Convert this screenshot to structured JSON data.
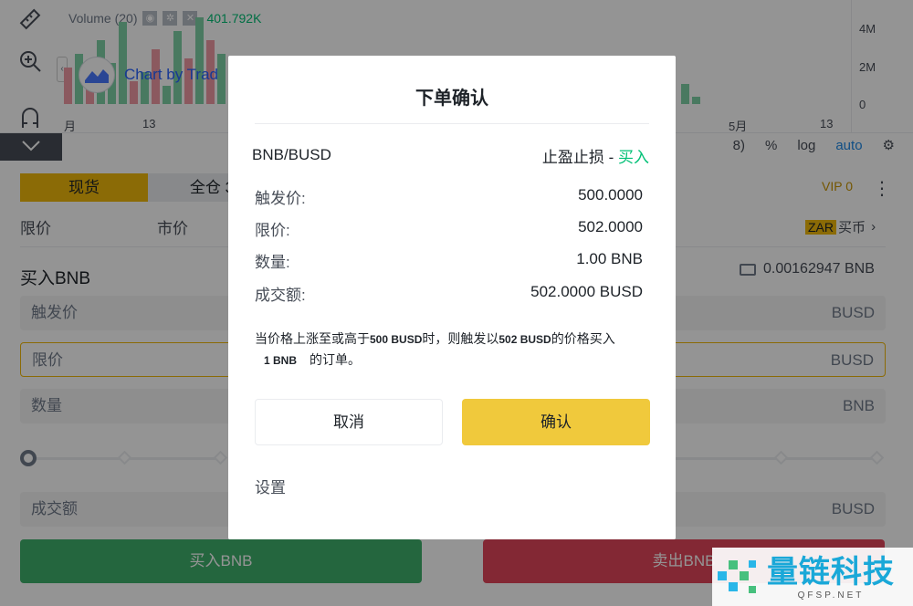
{
  "chart": {
    "legend_title": "Volume (20)",
    "legend_value": "401.792K",
    "tradingview_label": "Chart by Trad",
    "x_labels": [
      "月",
      "13",
      "5月",
      "13"
    ],
    "y_labels": [
      "4M",
      "2M",
      "0"
    ],
    "toolbar": {
      "partial": "8)",
      "percent": "%",
      "log": "log",
      "auto": "auto"
    }
  },
  "trade_panel": {
    "tabs": [
      "现货",
      "全仓 3"
    ],
    "vip": "VIP 0",
    "order_types": [
      "限价",
      "市价"
    ],
    "zar_badge": "ZAR",
    "buy_coin": "买币",
    "buy_title": "买入BNB",
    "balance": "0.00162947 BNB",
    "fields": {
      "trigger": {
        "placeholder": "触发价",
        "unit": "BUSD"
      },
      "limit": {
        "placeholder": "限价",
        "unit": "BUSD"
      },
      "amount": {
        "placeholder": "数量",
        "unit": "BNB"
      },
      "total": {
        "placeholder": "成交额",
        "unit": "BUSD"
      }
    },
    "buy_button": "买入BNB",
    "sell_button": "卖出BNB"
  },
  "modal": {
    "title": "下单确认",
    "pair": "BNB/BUSD",
    "order_type": "止盈止损 - ",
    "side": "买入",
    "rows": [
      {
        "label": "触发价:",
        "value": "500.0000"
      },
      {
        "label": "限价:",
        "value": "502.0000"
      },
      {
        "label": "数量:",
        "value": "1.00 BNB"
      },
      {
        "label": "成交额:",
        "value": "502.0000 BUSD"
      }
    ],
    "note": {
      "part1": "当价格上涨至或高于",
      "trigger": "500 BUSD",
      "part2": "时，则触发以",
      "limit": "502 BUSD",
      "part3": "的价格买入",
      "qty": "1 BNB",
      "part4": "的订单。"
    },
    "cancel_label": "取消",
    "confirm_label": "确认",
    "settings_label": "设置"
  },
  "watermark": {
    "cn": "量链科技",
    "en": "QFSP.NET"
  },
  "colors": {
    "accent": "#f0b90b",
    "buy": "#3fb06b",
    "sell": "#e2465a",
    "confirm": "#f0c93c",
    "up": "#02c076"
  }
}
